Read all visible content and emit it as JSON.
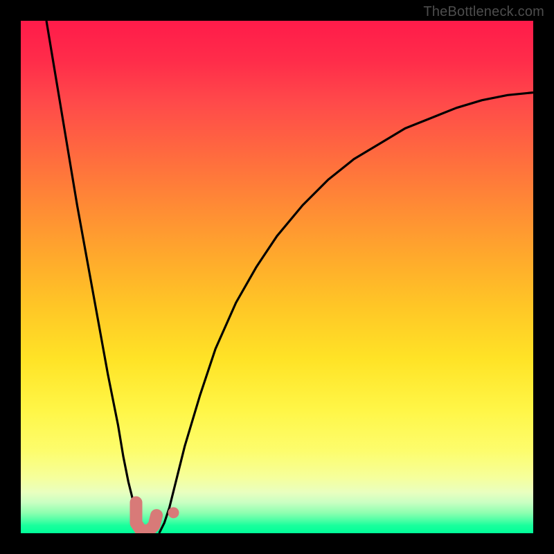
{
  "watermark": "TheBottleneck.com",
  "chart_data": {
    "type": "line",
    "title": "",
    "xlabel": "",
    "ylabel": "",
    "xlim": [
      0,
      100
    ],
    "ylim": [
      0,
      100
    ],
    "series": [
      {
        "name": "left-curve",
        "x": [
          5,
          7,
          9,
          11,
          13,
          15,
          17,
          19,
          20,
          21,
          22,
          23,
          24,
          25
        ],
        "y": [
          100,
          88,
          76,
          64,
          53,
          42,
          31,
          21,
          15,
          10,
          6,
          3,
          1,
          0
        ]
      },
      {
        "name": "right-curve",
        "x": [
          27,
          28,
          29,
          30,
          32,
          35,
          38,
          42,
          46,
          50,
          55,
          60,
          65,
          70,
          75,
          80,
          85,
          90,
          95,
          100
        ],
        "y": [
          0,
          2,
          5,
          9,
          17,
          27,
          36,
          45,
          52,
          58,
          64,
          69,
          73,
          76,
          79,
          81,
          83,
          84.5,
          85.5,
          86
        ]
      },
      {
        "name": "marker-stroke",
        "x": [
          22.5,
          22.5,
          23.5,
          25,
          26,
          26.5
        ],
        "y": [
          6,
          2,
          0.5,
          0.5,
          1.5,
          3.5
        ]
      },
      {
        "name": "marker-dot",
        "x": [
          29.8
        ],
        "y": [
          4
        ]
      }
    ],
    "colors": {
      "curve": "#000000",
      "marker": "#d87a78"
    }
  }
}
